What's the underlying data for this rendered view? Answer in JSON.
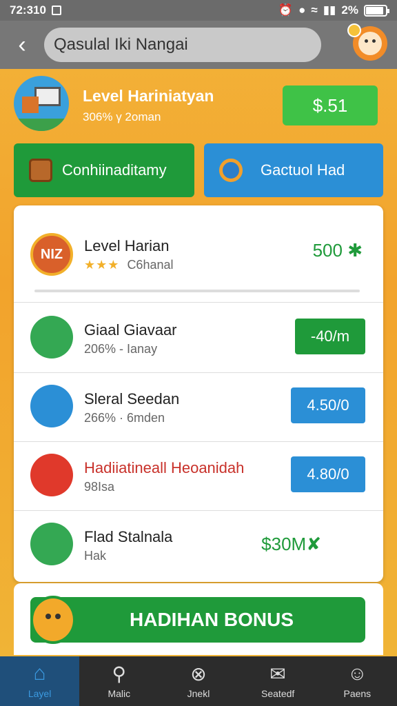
{
  "status_bar": {
    "time": "72:310",
    "battery": "2%",
    "battery_level": 0.9
  },
  "top_bar": {
    "search_text": "Qasulal Iki Nangai"
  },
  "level_header": {
    "title": "Level Hariniatyan",
    "subtitle": "306% γ 2oman",
    "price": "$.51"
  },
  "actions": {
    "left_label": "Conhiinaditamy",
    "right_label": "Gactuol Had"
  },
  "items": [
    {
      "name": "Level Harian",
      "meta": "C6hanal",
      "stars": "★★★",
      "value": "500",
      "value_suffix": "✱",
      "badge_text": "NIZ"
    },
    {
      "name": "Giaal Giavaar",
      "meta": "206% - Ianay",
      "value": "-40/m"
    },
    {
      "name": "Sleral Seedan",
      "meta": "266% · 6mden",
      "value": "4.50/0"
    },
    {
      "name": "Hadiiatineall Heoanidah",
      "meta": "98Isa",
      "value": "4.80/0"
    },
    {
      "name": "Flad Stalnala",
      "meta": "Hak",
      "value": "$30M✘"
    }
  ],
  "bonus": {
    "label": "HADIHAN BONUS"
  },
  "nav": [
    {
      "label": "Layel",
      "icon": "home-icon"
    },
    {
      "label": "Malic",
      "icon": "location-pin-icon"
    },
    {
      "label": "Jnekl",
      "icon": "close-circle-icon"
    },
    {
      "label": "Seatedf",
      "icon": "mail-icon"
    },
    {
      "label": "Paens",
      "icon": "person-icon"
    }
  ],
  "colors": {
    "accent_green": "#1f9a3a",
    "accent_blue": "#2b8fd6",
    "bg_orange": "#f2a32c"
  }
}
